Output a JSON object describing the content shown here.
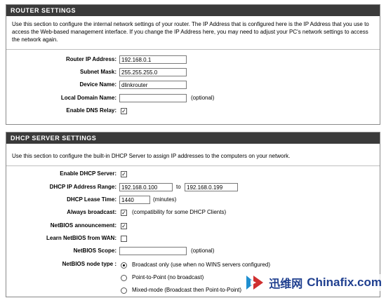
{
  "router_settings": {
    "title": "ROUTER SETTINGS",
    "description": "Use this section to configure the internal network settings of your router. The IP Address that is configured here is the IP Address that you use to access the Web-based management interface. If you change the IP Address here, you may need to adjust your PC's network settings to access the network again.",
    "router_ip_label": "Router IP Address:",
    "router_ip_value": "192.168.0.1",
    "subnet_mask_label": "Subnet Mask:",
    "subnet_mask_value": "255.255.255.0",
    "device_name_label": "Device Name:",
    "device_name_value": "dlinkrouter",
    "local_domain_label": "Local Domain Name:",
    "local_domain_value": "",
    "local_domain_note": "(optional)",
    "dns_relay_label": "Enable DNS Relay:",
    "dns_relay_checked": true
  },
  "dhcp_settings": {
    "title": "DHCP SERVER SETTINGS",
    "description": "Use this section to configure the built-in DHCP Server to assign IP addresses to the computers on your network.",
    "enable_dhcp_label": "Enable DHCP Server:",
    "enable_dhcp_checked": true,
    "range_label": "DHCP IP Address Range:",
    "range_start": "192.168.0.100",
    "range_to": "to",
    "range_end": "192.168.0.199",
    "lease_label": "DHCP Lease Time:",
    "lease_value": "1440",
    "lease_note": "(minutes)",
    "always_broadcast_label": "Always broadcast:",
    "always_broadcast_checked": true,
    "always_broadcast_note": "(compatibility for some DHCP Clients)",
    "netbios_announce_label": "NetBIOS announcement:",
    "netbios_announce_checked": true,
    "learn_netbios_label": "Learn NetBIOS from WAN:",
    "learn_netbios_checked": false,
    "netbios_scope_label": "NetBIOS Scope:",
    "netbios_scope_value": "",
    "netbios_scope_note": "(optional)",
    "node_type_label": "NetBIOS node type :",
    "node_options": [
      "Broadcast only (use when no WINS servers configured)",
      "Point-to-Point (no broadcast)",
      "Mixed-mode (Broadcast then Point-to-Point)"
    ],
    "node_selected": 0
  },
  "watermark": {
    "cn": "迅维网",
    "en": "Chinafix.com"
  }
}
